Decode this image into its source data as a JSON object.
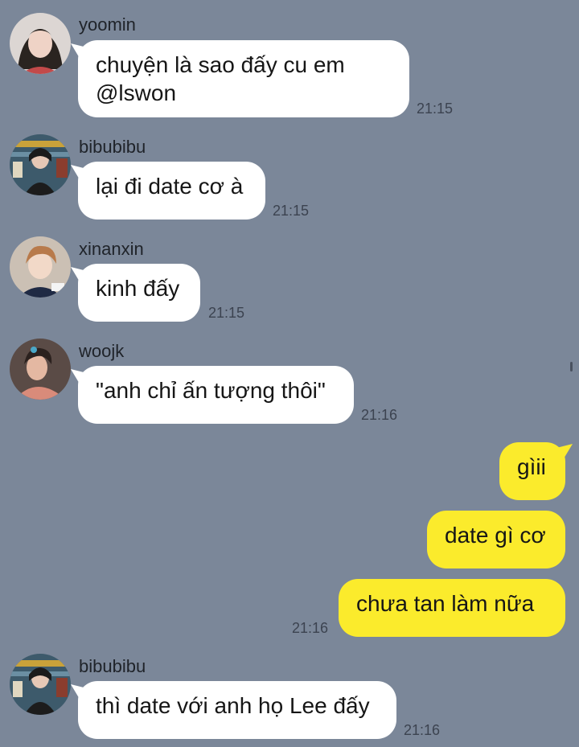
{
  "chat": {
    "messages": [
      {
        "sender": "yoomin",
        "lines": [
          "chuyện là sao đấy cu em",
          "@lswon"
        ],
        "time": "21:15",
        "direction": "in",
        "avatar_icon": "yoomin-avatar-icon"
      },
      {
        "sender": "bibubibu",
        "lines": [
          "lại đi date cơ à"
        ],
        "time": "21:15",
        "direction": "in",
        "avatar_icon": "bibubibu-avatar-icon"
      },
      {
        "sender": "xinanxin",
        "lines": [
          "kinh đấy"
        ],
        "time": "21:15",
        "direction": "in",
        "avatar_icon": "xinanxin-avatar-icon"
      },
      {
        "sender": "woojk",
        "lines": [
          "\"anh chỉ ấn tượng thôi\""
        ],
        "time": "21:16",
        "direction": "in",
        "avatar_icon": "woojk-avatar-icon"
      },
      {
        "lines": [
          "gìii"
        ],
        "direction": "out"
      },
      {
        "lines": [
          "date gì cơ"
        ],
        "direction": "out"
      },
      {
        "lines": [
          "chưa tan làm nữa"
        ],
        "time": "21:16",
        "direction": "out"
      },
      {
        "sender": "bibubibu",
        "lines": [
          "thì date với anh họ Lee đấy"
        ],
        "time": "21:16",
        "direction": "in",
        "avatar_icon": "bibubibu-avatar-icon"
      }
    ]
  },
  "colors": {
    "background": "#7b8799",
    "incoming_bubble": "#ffffff",
    "outgoing_bubble": "#fbeb2c"
  }
}
